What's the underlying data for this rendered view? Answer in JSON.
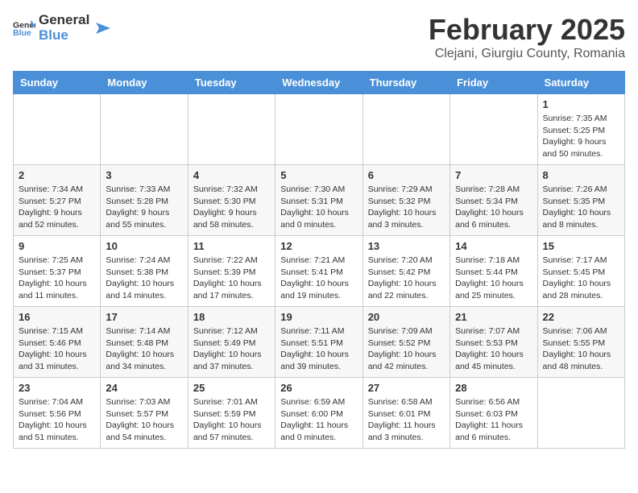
{
  "header": {
    "logo": {
      "text_general": "General",
      "text_blue": "Blue"
    },
    "month_title": "February 2025",
    "location": "Clejani, Giurgiu County, Romania"
  },
  "calendar": {
    "headers": [
      "Sunday",
      "Monday",
      "Tuesday",
      "Wednesday",
      "Thursday",
      "Friday",
      "Saturday"
    ],
    "weeks": [
      [
        {
          "day": "",
          "info": ""
        },
        {
          "day": "",
          "info": ""
        },
        {
          "day": "",
          "info": ""
        },
        {
          "day": "",
          "info": ""
        },
        {
          "day": "",
          "info": ""
        },
        {
          "day": "",
          "info": ""
        },
        {
          "day": "1",
          "info": "Sunrise: 7:35 AM\nSunset: 5:25 PM\nDaylight: 9 hours and 50 minutes."
        }
      ],
      [
        {
          "day": "2",
          "info": "Sunrise: 7:34 AM\nSunset: 5:27 PM\nDaylight: 9 hours and 52 minutes."
        },
        {
          "day": "3",
          "info": "Sunrise: 7:33 AM\nSunset: 5:28 PM\nDaylight: 9 hours and 55 minutes."
        },
        {
          "day": "4",
          "info": "Sunrise: 7:32 AM\nSunset: 5:30 PM\nDaylight: 9 hours and 58 minutes."
        },
        {
          "day": "5",
          "info": "Sunrise: 7:30 AM\nSunset: 5:31 PM\nDaylight: 10 hours and 0 minutes."
        },
        {
          "day": "6",
          "info": "Sunrise: 7:29 AM\nSunset: 5:32 PM\nDaylight: 10 hours and 3 minutes."
        },
        {
          "day": "7",
          "info": "Sunrise: 7:28 AM\nSunset: 5:34 PM\nDaylight: 10 hours and 6 minutes."
        },
        {
          "day": "8",
          "info": "Sunrise: 7:26 AM\nSunset: 5:35 PM\nDaylight: 10 hours and 8 minutes."
        }
      ],
      [
        {
          "day": "9",
          "info": "Sunrise: 7:25 AM\nSunset: 5:37 PM\nDaylight: 10 hours and 11 minutes."
        },
        {
          "day": "10",
          "info": "Sunrise: 7:24 AM\nSunset: 5:38 PM\nDaylight: 10 hours and 14 minutes."
        },
        {
          "day": "11",
          "info": "Sunrise: 7:22 AM\nSunset: 5:39 PM\nDaylight: 10 hours and 17 minutes."
        },
        {
          "day": "12",
          "info": "Sunrise: 7:21 AM\nSunset: 5:41 PM\nDaylight: 10 hours and 19 minutes."
        },
        {
          "day": "13",
          "info": "Sunrise: 7:20 AM\nSunset: 5:42 PM\nDaylight: 10 hours and 22 minutes."
        },
        {
          "day": "14",
          "info": "Sunrise: 7:18 AM\nSunset: 5:44 PM\nDaylight: 10 hours and 25 minutes."
        },
        {
          "day": "15",
          "info": "Sunrise: 7:17 AM\nSunset: 5:45 PM\nDaylight: 10 hours and 28 minutes."
        }
      ],
      [
        {
          "day": "16",
          "info": "Sunrise: 7:15 AM\nSunset: 5:46 PM\nDaylight: 10 hours and 31 minutes."
        },
        {
          "day": "17",
          "info": "Sunrise: 7:14 AM\nSunset: 5:48 PM\nDaylight: 10 hours and 34 minutes."
        },
        {
          "day": "18",
          "info": "Sunrise: 7:12 AM\nSunset: 5:49 PM\nDaylight: 10 hours and 37 minutes."
        },
        {
          "day": "19",
          "info": "Sunrise: 7:11 AM\nSunset: 5:51 PM\nDaylight: 10 hours and 39 minutes."
        },
        {
          "day": "20",
          "info": "Sunrise: 7:09 AM\nSunset: 5:52 PM\nDaylight: 10 hours and 42 minutes."
        },
        {
          "day": "21",
          "info": "Sunrise: 7:07 AM\nSunset: 5:53 PM\nDaylight: 10 hours and 45 minutes."
        },
        {
          "day": "22",
          "info": "Sunrise: 7:06 AM\nSunset: 5:55 PM\nDaylight: 10 hours and 48 minutes."
        }
      ],
      [
        {
          "day": "23",
          "info": "Sunrise: 7:04 AM\nSunset: 5:56 PM\nDaylight: 10 hours and 51 minutes."
        },
        {
          "day": "24",
          "info": "Sunrise: 7:03 AM\nSunset: 5:57 PM\nDaylight: 10 hours and 54 minutes."
        },
        {
          "day": "25",
          "info": "Sunrise: 7:01 AM\nSunset: 5:59 PM\nDaylight: 10 hours and 57 minutes."
        },
        {
          "day": "26",
          "info": "Sunrise: 6:59 AM\nSunset: 6:00 PM\nDaylight: 11 hours and 0 minutes."
        },
        {
          "day": "27",
          "info": "Sunrise: 6:58 AM\nSunset: 6:01 PM\nDaylight: 11 hours and 3 minutes."
        },
        {
          "day": "28",
          "info": "Sunrise: 6:56 AM\nSunset: 6:03 PM\nDaylight: 11 hours and 6 minutes."
        },
        {
          "day": "",
          "info": ""
        }
      ]
    ]
  }
}
